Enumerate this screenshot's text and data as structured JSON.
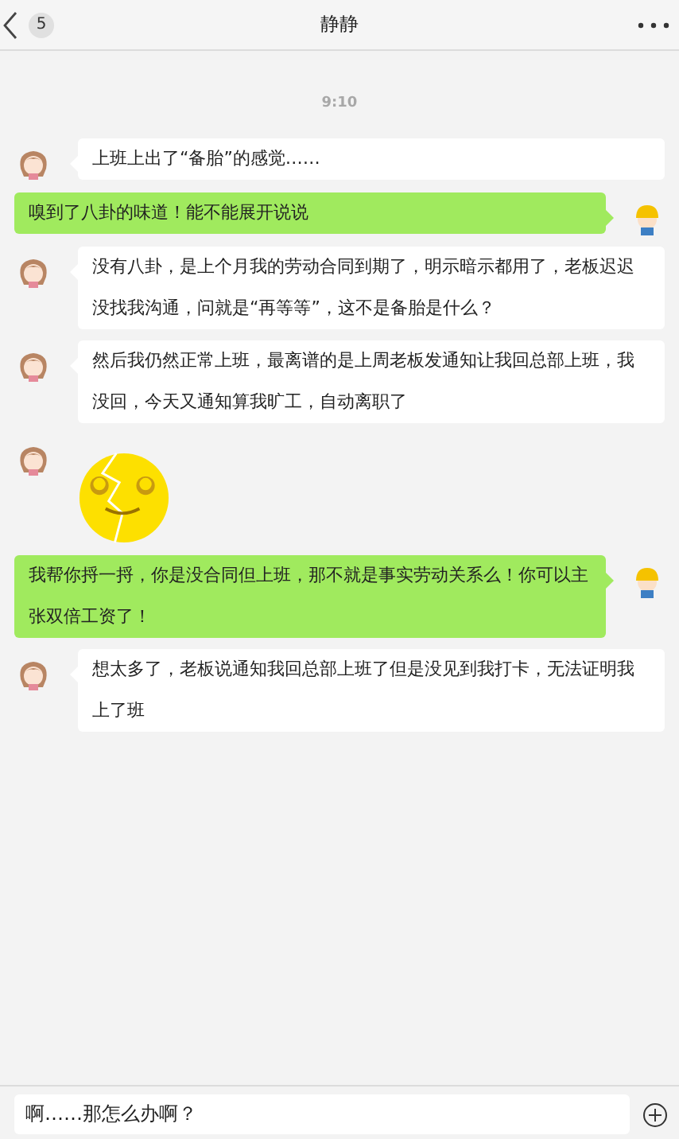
{
  "header": {
    "unread_count": "5",
    "title": "静静"
  },
  "time": "9:10",
  "messages": [
    {
      "outgoing": false,
      "kind": "text",
      "text": "上班上出了“备胎”的感觉……"
    },
    {
      "outgoing": true,
      "kind": "text",
      "text": "嗅到了八卦的味道！能不能展开说说"
    },
    {
      "outgoing": false,
      "kind": "text",
      "text": "没有八卦，是上个月我的劳动合同到期了，明示暗示都用了，老板迟迟没找我沟通，问就是“再等等”，这不是备胎是什么？"
    },
    {
      "outgoing": false,
      "kind": "text",
      "text": "然后我仍然正常上班，最离谱的是上周老板发通知让我回总部上班，我没回，今天又通知算我旷工，自动离职了"
    },
    {
      "outgoing": false,
      "kind": "sticker"
    },
    {
      "outgoing": true,
      "kind": "text",
      "text": "我帮你捋一捋，你是没合同但上班，那不就是事实劳动关系么！你可以主张双倍工资了！"
    },
    {
      "outgoing": false,
      "kind": "text",
      "text": "想太多了，老板说通知我回总部上班了但是没见到我打卡，无法证明我上了班"
    }
  ],
  "input": {
    "value": "啊……那怎么办啊？"
  }
}
